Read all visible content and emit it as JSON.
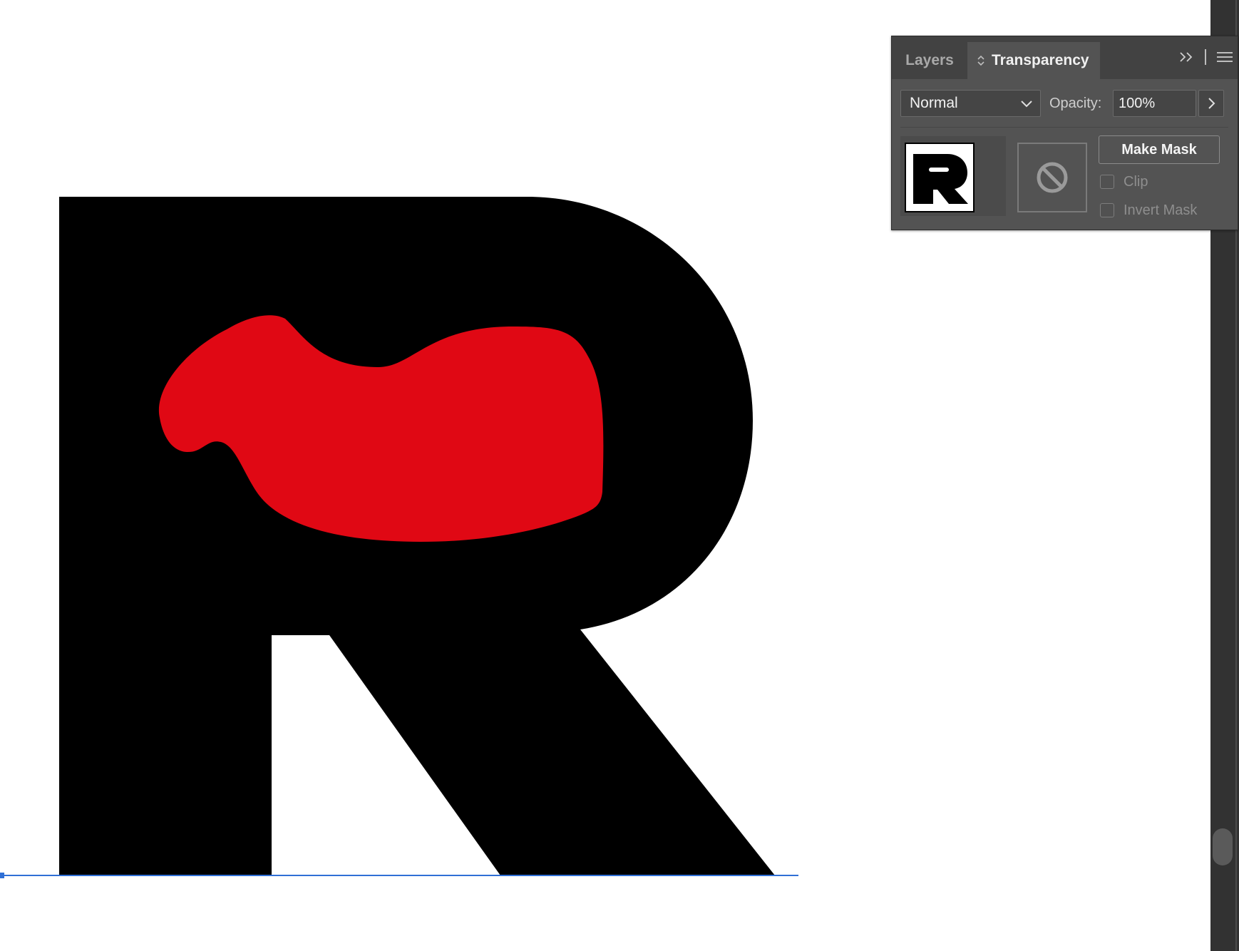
{
  "canvas": {
    "background": "#ffffff",
    "artwork": {
      "letter": "R",
      "letter_color": "#000000",
      "shape_color": "#e00814",
      "guide_color": "#2f6fd6"
    }
  },
  "panel": {
    "tabs": [
      {
        "label": "Layers",
        "active": false
      },
      {
        "label": "Transparency",
        "active": true
      }
    ],
    "blend_mode": {
      "value": "Normal"
    },
    "opacity": {
      "label": "Opacity:",
      "value": "100%"
    },
    "object_thumbnail": {
      "letter": "R"
    },
    "make_mask_label": "Make Mask",
    "clip": {
      "label": "Clip",
      "checked": false,
      "enabled": false
    },
    "invert_mask": {
      "label": "Invert Mask",
      "checked": false,
      "enabled": false
    },
    "icons": [
      "tab-arrows-icon",
      "collapse-icon",
      "panel-menu-icon",
      "chevron-down-icon",
      "chevron-right-icon",
      "no-mask-icon"
    ],
    "colors": {
      "panel_bg": "#535353",
      "tabbar_bg": "#424242",
      "field_bg": "#454545"
    }
  }
}
